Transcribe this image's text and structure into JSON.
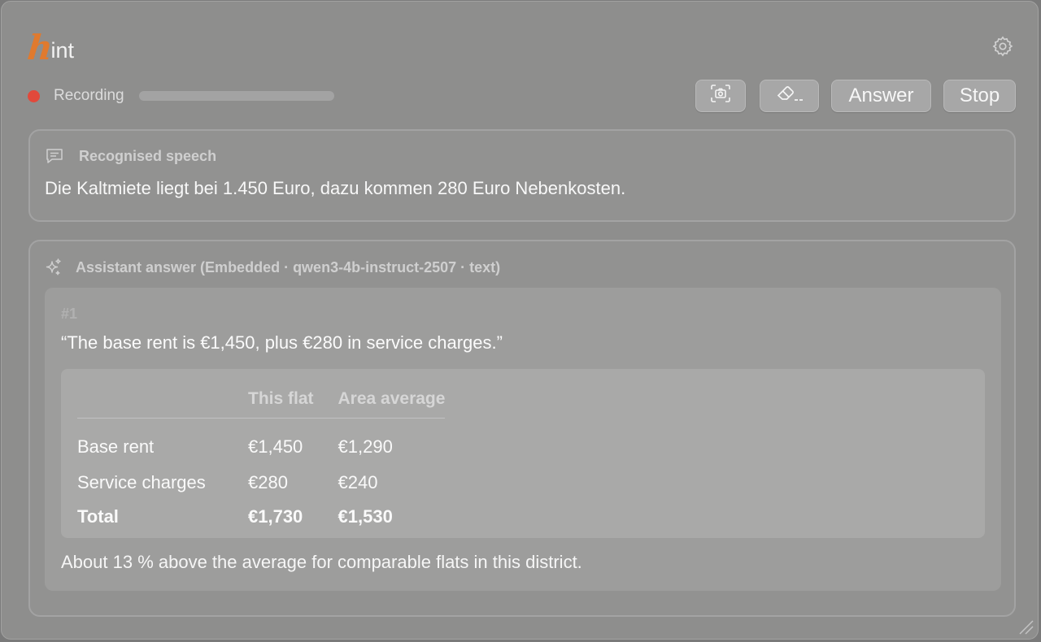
{
  "app": {
    "logo_initial": "h",
    "logo_rest": "int"
  },
  "toolbar": {
    "recording_label": "Recording",
    "level_fraction": 0.0,
    "screenshot_icon": "camera-screenshot-icon",
    "clear_icon": "eraser-icon",
    "answer_label": "Answer",
    "stop_label": "Stop",
    "settings_icon": "gear-icon"
  },
  "speech": {
    "icon": "speech-bubble-icon",
    "header": "Recognised speech",
    "text": "Die Kaltmiete liegt bei 1.450 Euro, dazu kommen 280 Euro Nebenkosten."
  },
  "answer": {
    "icon": "sparkle-icon",
    "header": "Assistant answer (Embedded · qwen3-4b-instruct-2507 · text)",
    "card": {
      "number": "#1",
      "quote": "“The base rent is €1,450, plus €280 in service charges.”",
      "table": {
        "headers": [
          "",
          "This flat",
          "Area average"
        ],
        "rows": [
          [
            "Base rent",
            "€1,450",
            "€1,290"
          ],
          [
            "Service charges",
            "€280",
            "€240"
          ],
          [
            "Total",
            "€1,730",
            "€1,530"
          ]
        ]
      },
      "footnote": "About 13 % above the average for comparable flats in this district."
    }
  },
  "colors": {
    "accent_orange": "#e07a2e",
    "recording_red": "#e2493b"
  }
}
